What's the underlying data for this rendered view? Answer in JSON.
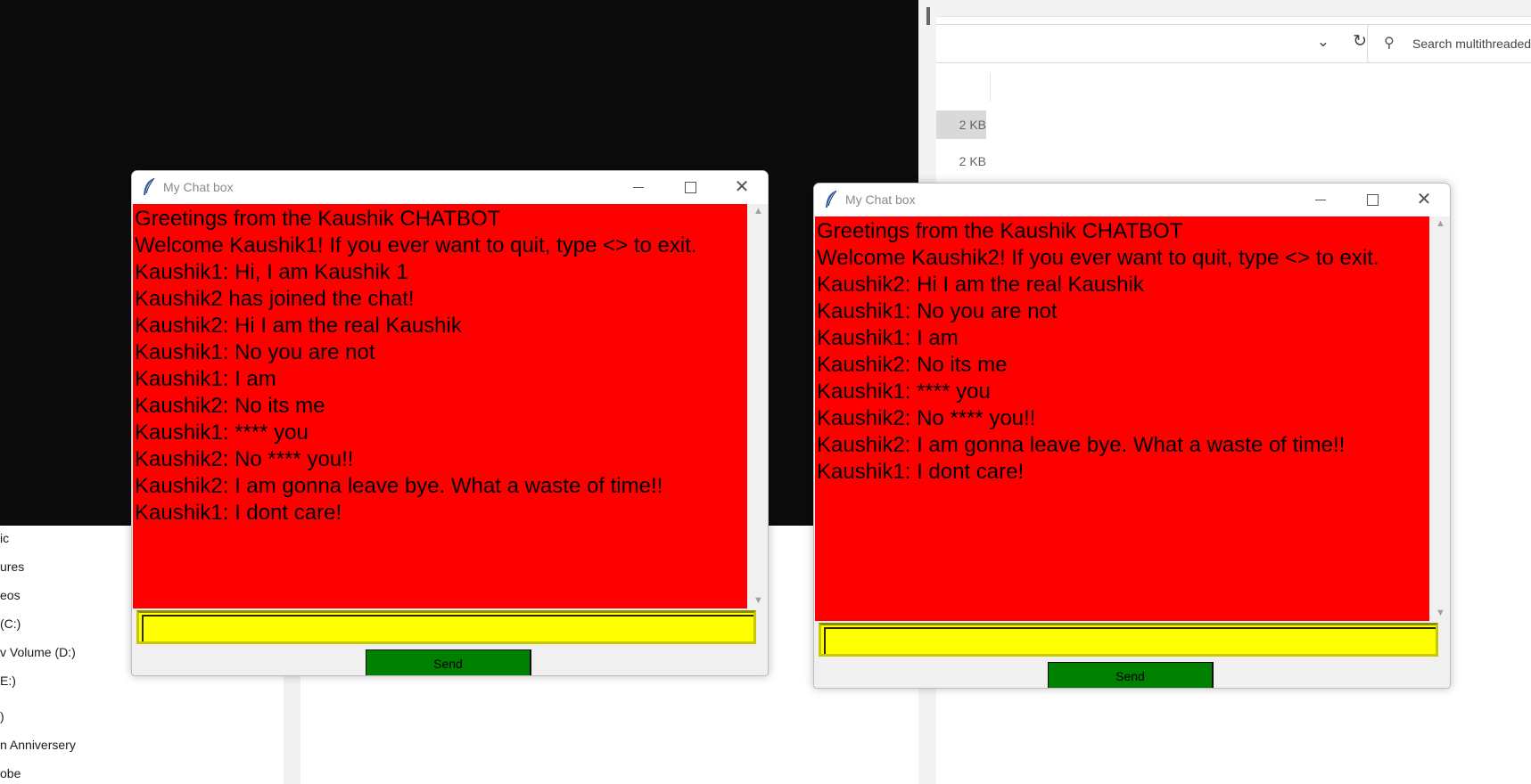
{
  "explorer": {
    "search_placeholder": "Search multithreaded",
    "file_sizes": [
      "2 KB",
      "2 KB"
    ],
    "nav_items": [
      "ic",
      "ures",
      "eos",
      "(C:)",
      "v Volume (D:)",
      "E:)",
      ")",
      "n Anniversery",
      "obe"
    ]
  },
  "chat_windows": [
    {
      "title": "My Chat box",
      "send_label": "Send",
      "entry_value": "",
      "messages": [
        "Greetings from the Kaushik CHATBOT",
        "Welcome Kaushik1! If you ever want to quit, type <> to exit.",
        "Kaushik1: Hi, I am Kaushik 1",
        "Kaushik2 has joined the chat!",
        "Kaushik2: Hi I am the real Kaushik",
        "Kaushik1: No you are not",
        "Kaushik1: I am",
        "Kaushik2: No its me",
        "Kaushik1: **** you",
        "Kaushik2: No **** you!!",
        "Kaushik2: I am gonna leave bye. What a waste of time!!",
        "Kaushik1: I dont care!"
      ]
    },
    {
      "title": "My Chat box",
      "send_label": "Send",
      "entry_value": "",
      "messages": [
        "Greetings from the Kaushik CHATBOT",
        "Welcome Kaushik2! If you ever want to quit, type <> to exit.",
        "Kaushik2: Hi I am the real Kaushik",
        "Kaushik1: No you are not",
        "Kaushik1: I am",
        "Kaushik2: No its me",
        "Kaushik1: **** you",
        "Kaushik2: No **** you!!",
        "Kaushik2: I am gonna leave bye. What a waste of time!!",
        "Kaushik1: I dont care!"
      ]
    }
  ],
  "colors": {
    "message_background": "#ff0000",
    "entry_background": "#ffff00",
    "send_button": "#008000",
    "terminal_background": "#0c0c0c"
  }
}
